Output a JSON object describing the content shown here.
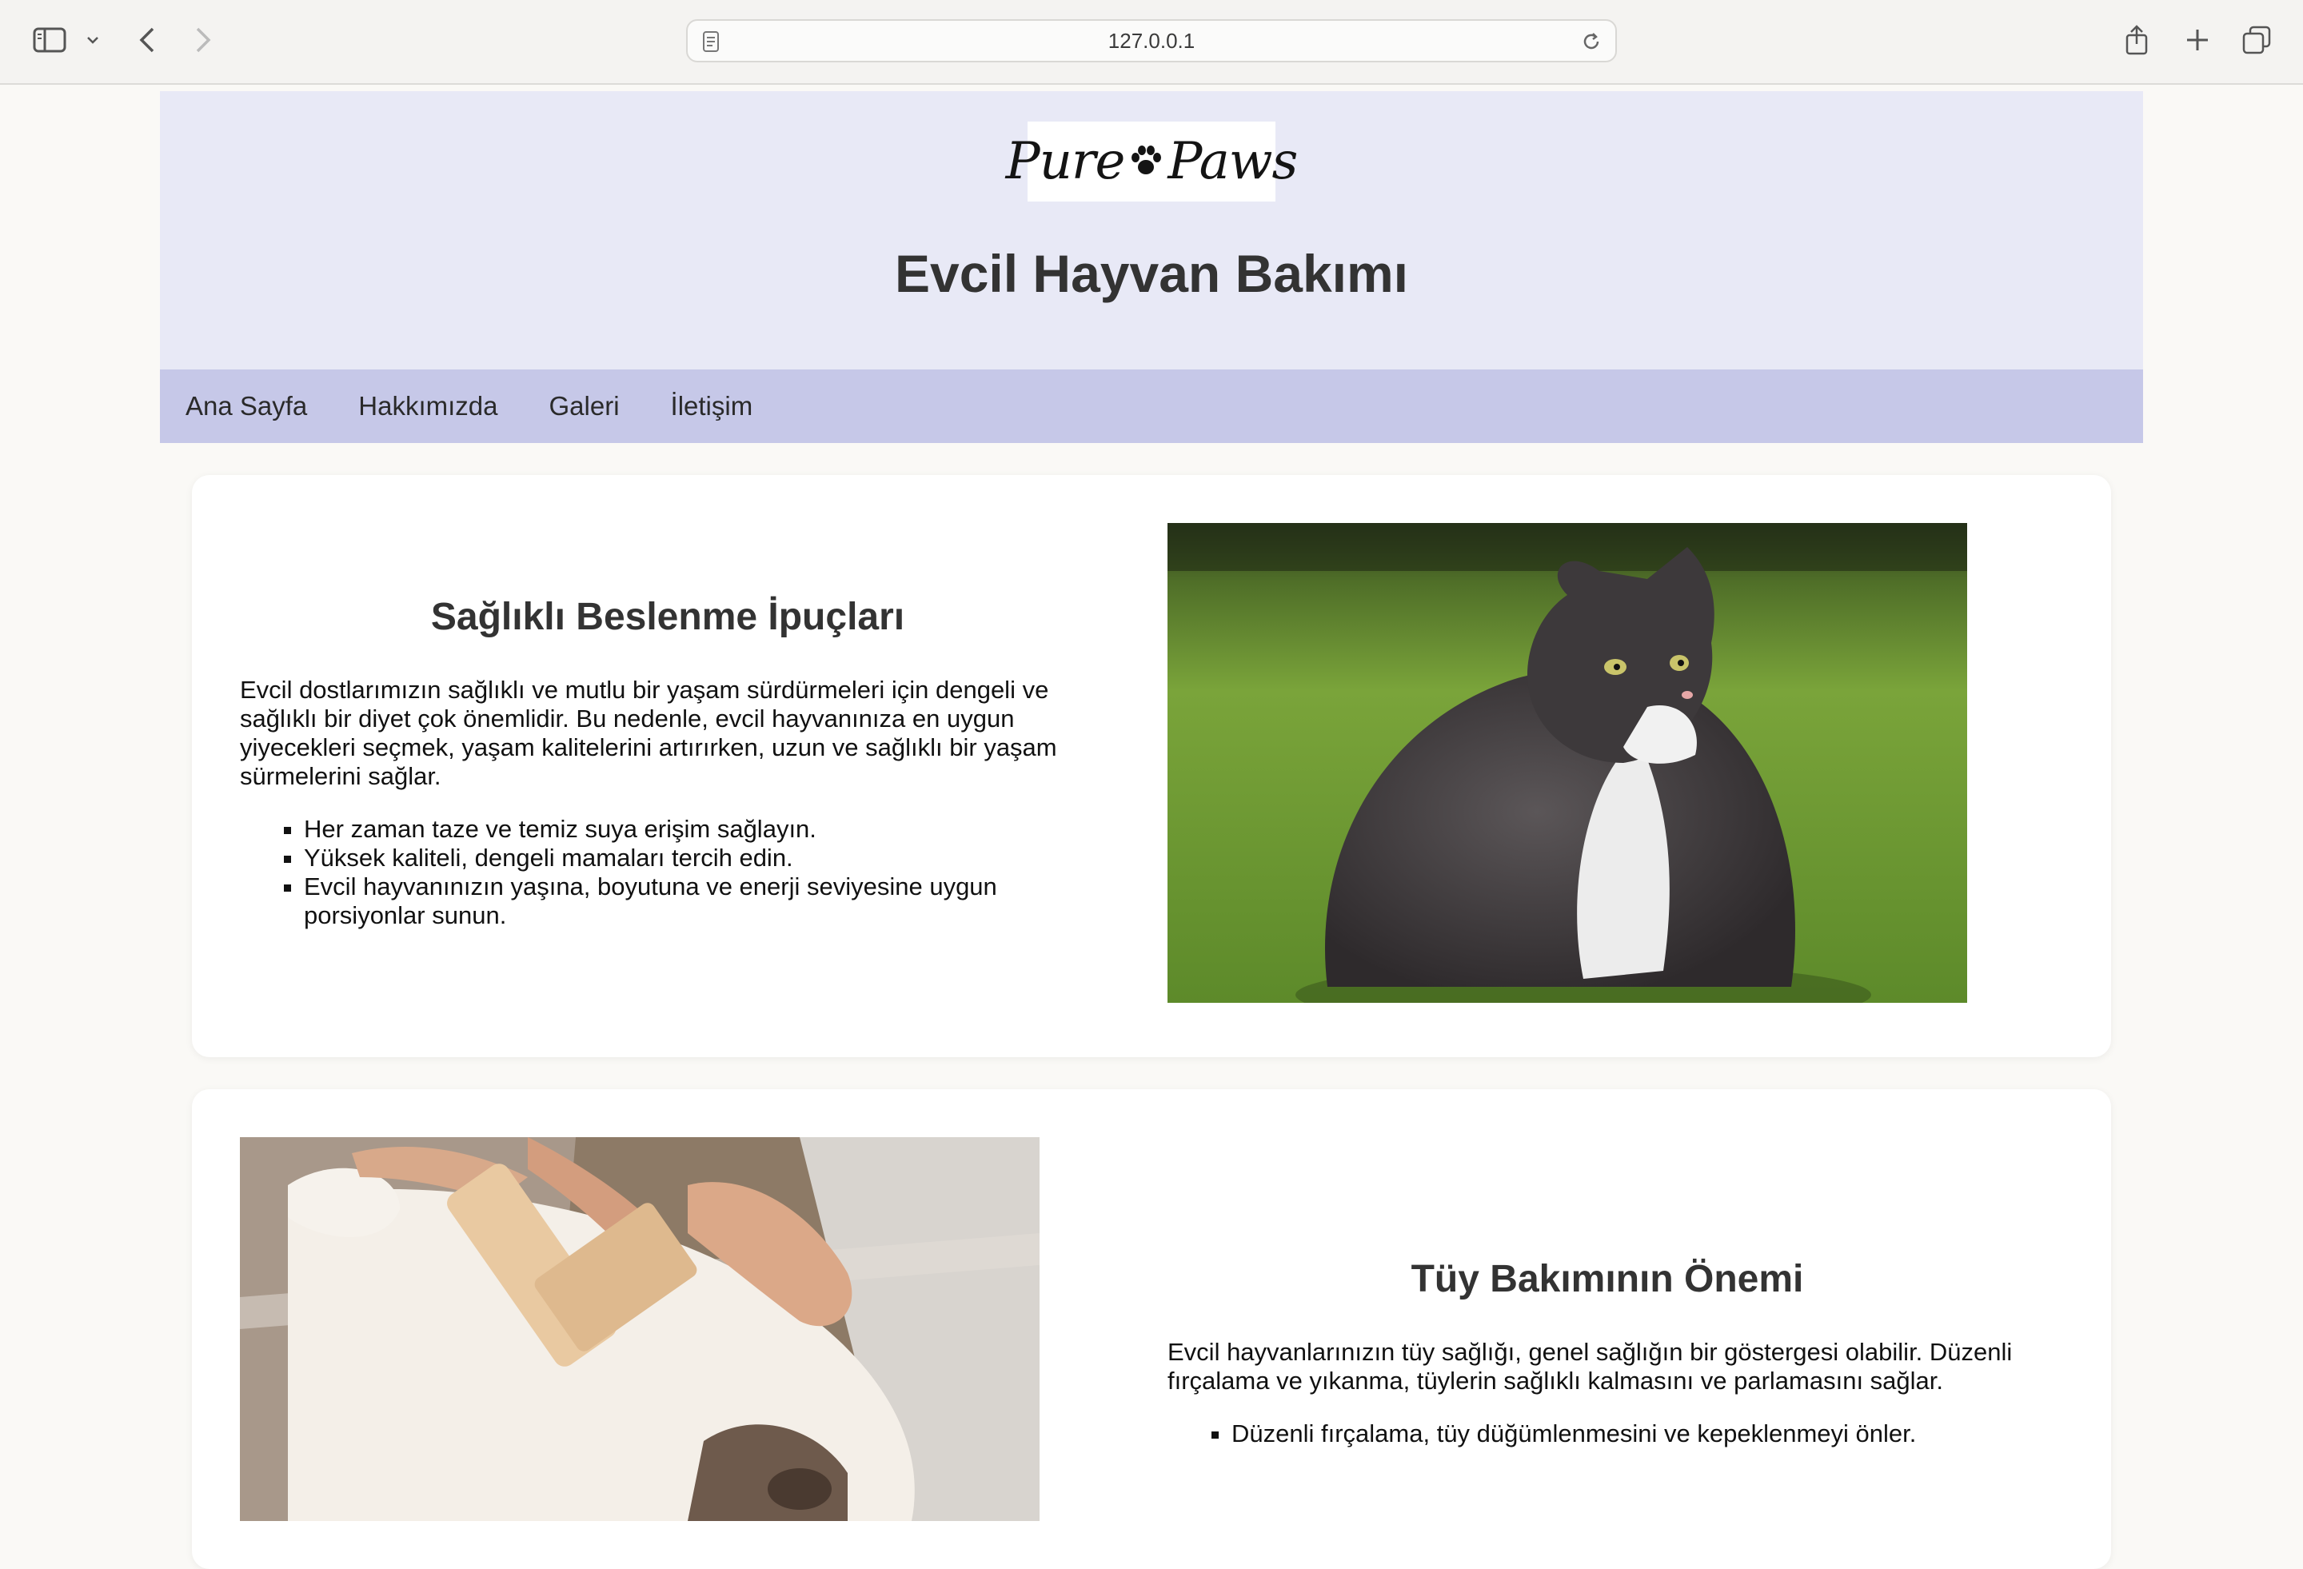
{
  "browser": {
    "url": "127.0.0.1"
  },
  "header": {
    "logo_text": "Pure Paws",
    "title": "Evcil Hayvan Bakımı"
  },
  "nav": {
    "items": [
      "Ana Sayfa",
      "Hakkımızda",
      "Galeri",
      "İletişim"
    ]
  },
  "sections": [
    {
      "heading": "Sağlıklı Beslenme İpuçları",
      "paragraph": "Evcil dostlarımızın sağlıklı ve mutlu bir yaşam sürdürmeleri için dengeli ve sağlıklı bir diyet çok önemlidir. Bu nedenle, evcil hayvanınıza en uygun yiyecekleri seçmek, yaşam kalitelerini artırırken, uzun ve sağlıklı bir yaşam sürmelerini sağlar.",
      "bullets": [
        "Her zaman taze ve temiz suya erişim sağlayın.",
        "Yüksek kaliteli, dengeli mamaları tercih edin.",
        "Evcil hayvanınızın yaşına, boyutuna ve enerji seviyesine uygun porsiyonlar sunun."
      ]
    },
    {
      "heading": "Tüy Bakımının Önemi",
      "paragraph": "Evcil hayvanlarınızın tüy sağlığı, genel sağlığın bir göstergesi olabilir. Düzenli fırçalama ve yıkanma, tüylerin sağlıklı kalmasını ve parlamasını sağlar.",
      "bullets": [
        "Düzenli fırçalama, tüy düğümlenmesini ve kepeklenmeyi önler."
      ]
    }
  ],
  "colors": {
    "header_bg": "#e8e9f6",
    "nav_bg": "#c6c8e8",
    "page_bg": "#faf9f6"
  }
}
